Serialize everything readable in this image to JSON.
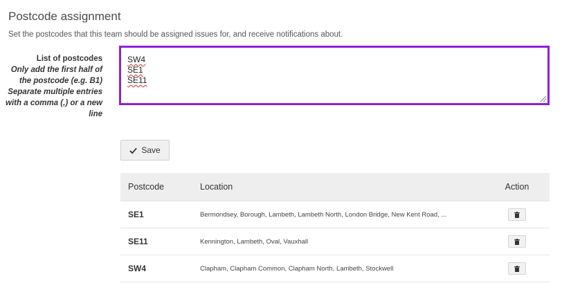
{
  "section": {
    "title": "Postcode assignment",
    "description": "Set the postcodes that this team should be assigned issues for, and receive notifications about."
  },
  "field": {
    "label": "List of postcodes",
    "help": "Only add the first half of the postcode (e.g. B1) Separate multiple entries with a comma (,) or a new line",
    "value": "SW4\nSE1\nSE11"
  },
  "save_button": {
    "label": "Save",
    "icon": "checkmark-icon"
  },
  "table": {
    "headers": {
      "postcode": "Postcode",
      "location": "Location",
      "action": "Action"
    },
    "rows": [
      {
        "postcode": "SE1",
        "location": "Bermondsey, Borough, Lambeth, Lambeth North, London Bridge, New Kent Road, ...",
        "action_icon": "trash-icon"
      },
      {
        "postcode": "SE11",
        "location": "Kennington, Lambeth, Oval, Vauxhall",
        "action_icon": "trash-icon"
      },
      {
        "postcode": "SW4",
        "location": "Clapham, Clapham Common, Clapham North, Lambeth, Stockwell",
        "action_icon": "trash-icon"
      }
    ]
  },
  "colors": {
    "focus_border": "#8e1fd9",
    "spellcheck_underline": "#d0302b",
    "table_header_bg": "#eeeeee"
  }
}
